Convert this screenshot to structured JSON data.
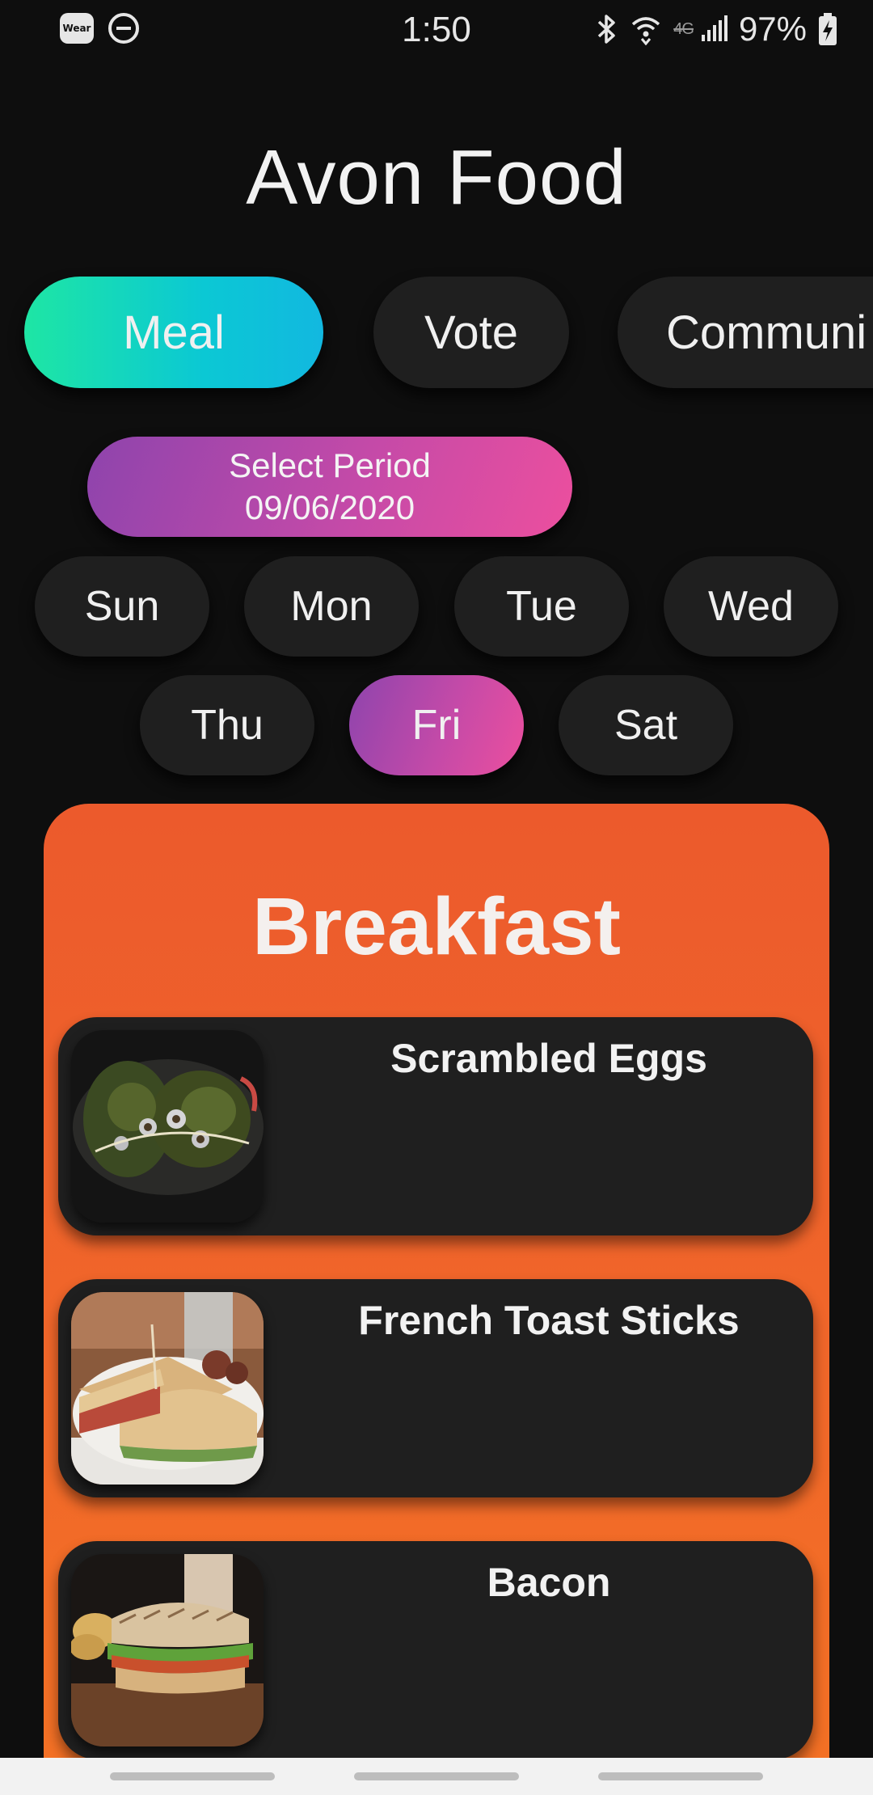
{
  "status_bar": {
    "time": "1:50",
    "network": "4G",
    "battery": "97%",
    "left_icons": [
      "wear-icon",
      "do-not-disturb-icon"
    ],
    "right_icons": [
      "bluetooth-icon",
      "wifi-icon",
      "signal-icon",
      "battery-charging-icon"
    ],
    "wear_label": "Wear"
  },
  "app": {
    "title": "Avon Food"
  },
  "tabs": [
    {
      "label": "Meal",
      "active": true
    },
    {
      "label": "Vote",
      "active": false
    },
    {
      "label": "Communi",
      "active": false
    }
  ],
  "period": {
    "label": "Select Period",
    "date": "09/06/2020"
  },
  "days": [
    {
      "label": "Sun",
      "active": false
    },
    {
      "label": "Mon",
      "active": false
    },
    {
      "label": "Tue",
      "active": false
    },
    {
      "label": "Wed",
      "active": false
    },
    {
      "label": "Thu",
      "active": false
    },
    {
      "label": "Fri",
      "active": true
    },
    {
      "label": "Sat",
      "active": false
    }
  ],
  "meal": {
    "heading": "Breakfast",
    "items": [
      {
        "name": "Scrambled Eggs"
      },
      {
        "name": "French Toast Sticks"
      },
      {
        "name": "Bacon"
      }
    ]
  },
  "colors": {
    "background": "#0e0e0e",
    "pill": "#1f1f1f",
    "meal_tab_gradient": [
      "#1ee6a4",
      "#12b8e0"
    ],
    "active_gradient": [
      "#8e44ad",
      "#ec4f9e"
    ],
    "card_gradient": [
      "#ec5a2c",
      "#f47324"
    ]
  }
}
